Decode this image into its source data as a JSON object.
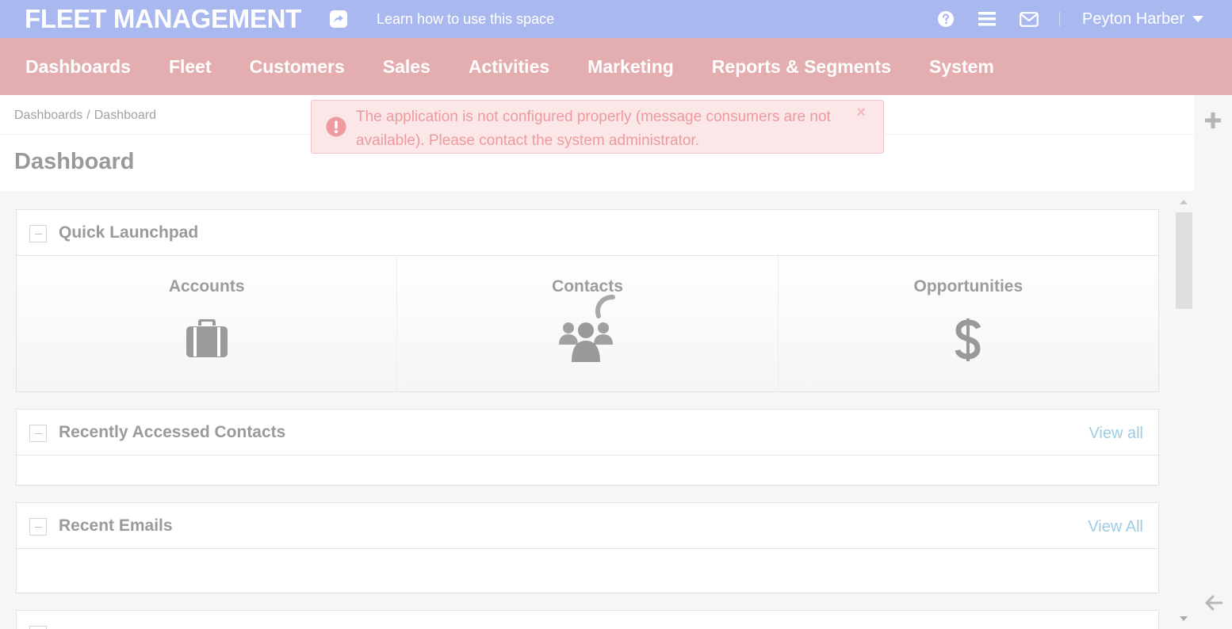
{
  "topbar": {
    "brand": "FLEET MANAGEMENT",
    "learn_link": "Learn how to use this space",
    "user_name": "Peyton Harber",
    "icons": [
      "share-icon",
      "help-icon",
      "menu-icon",
      "mail-icon",
      "caret-down-icon"
    ]
  },
  "mainnav": {
    "items": [
      "Dashboards",
      "Fleet",
      "Customers",
      "Sales",
      "Activities",
      "Marketing",
      "Reports & Segments",
      "System"
    ]
  },
  "breadcrumb": {
    "parent": "Dashboards",
    "separator": "/",
    "current": "Dashboard"
  },
  "page_title": "Dashboard",
  "alert": {
    "text": "The application is not configured properly (message consumers are not available). Please contact the system administrator.",
    "close": "×"
  },
  "widgets": {
    "quick_launchpad": {
      "title": "Quick Launchpad",
      "items": [
        {
          "label": "Accounts",
          "icon": "briefcase-icon"
        },
        {
          "label": "Contacts",
          "icon": "users-icon"
        },
        {
          "label": "Opportunities",
          "icon": "dollar-icon"
        }
      ]
    },
    "recent_contacts": {
      "title": "Recently Accessed Contacts",
      "view_all": "View all"
    },
    "recent_emails": {
      "title": "Recent Emails",
      "view_all": "View All"
    }
  },
  "colors": {
    "topbar": "#a9b8ef",
    "mainnav": "#e4aeb0",
    "alert_bg": "#fce7e8",
    "alert_text": "#ec9a9e",
    "link": "#9ecde3"
  }
}
